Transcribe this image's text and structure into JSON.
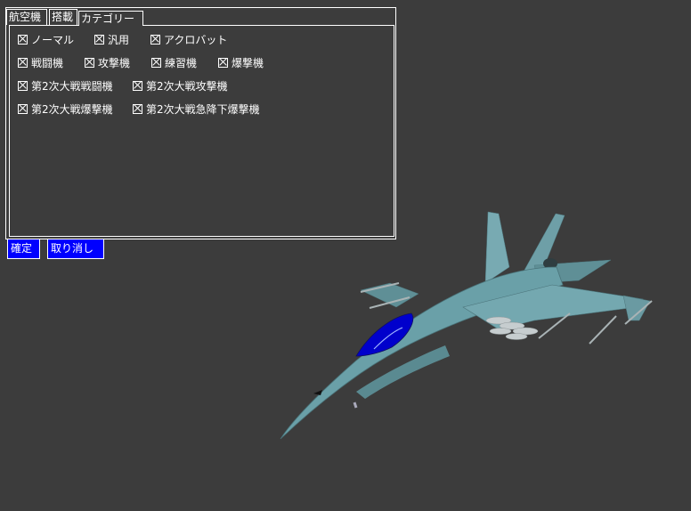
{
  "tabs": [
    {
      "label": "航空機"
    },
    {
      "label": "搭載"
    },
    {
      "label": "カテゴリー",
      "active": true
    }
  ],
  "categories": {
    "row1": [
      "ノーマル",
      "汎用",
      "アクロバット"
    ],
    "row2": [
      "戦闘機",
      "攻撃機",
      "練習機",
      "爆撃機"
    ],
    "row3": [
      "第2次大戦戦闘機",
      "第2次大戦攻撃機"
    ],
    "row4": [
      "第2次大戦爆撃機",
      "第2次大戦急降下爆撃機"
    ]
  },
  "checked_all": true,
  "buttons": {
    "confirm": "確定",
    "cancel": "取り消し"
  },
  "colors": {
    "background": "#3c3c3c",
    "button": "#0000ff",
    "aircraft_body": "#6aa0a8",
    "canopy": "#0000cc"
  },
  "preview": {
    "icon": "fighter-jet-3d-model"
  }
}
